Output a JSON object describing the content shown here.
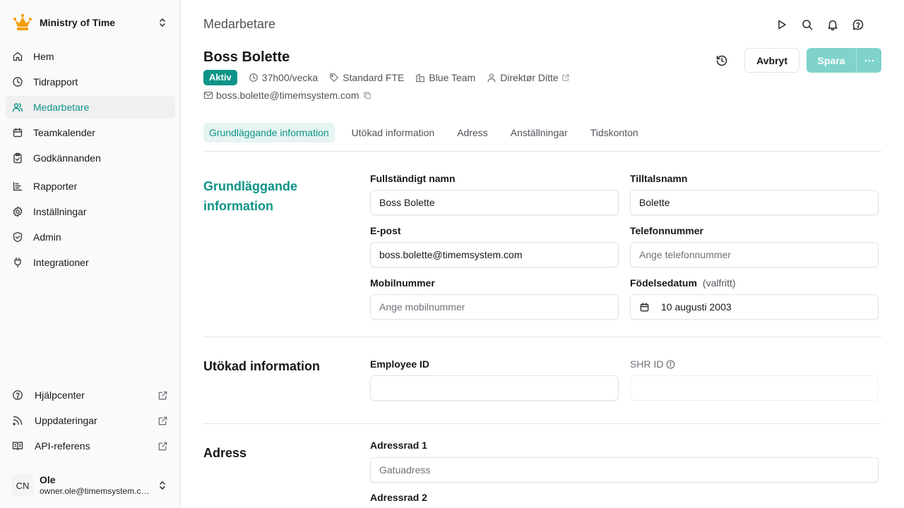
{
  "org": {
    "name": "Ministry of Time"
  },
  "nav": [
    {
      "label": "Hem"
    },
    {
      "label": "Tidrapport"
    },
    {
      "label": "Medarbetare"
    },
    {
      "label": "Teamkalender"
    },
    {
      "label": "Godkännanden"
    },
    {
      "label": "Rapporter"
    },
    {
      "label": "Inställningar"
    },
    {
      "label": "Admin"
    },
    {
      "label": "Integrationer"
    }
  ],
  "bottom_nav": [
    {
      "label": "Hjälpcenter"
    },
    {
      "label": "Uppdateringar"
    },
    {
      "label": "API-referens"
    }
  ],
  "user": {
    "initials": "CN",
    "name": "Ole",
    "email": "owner.ole@timemsystem.com"
  },
  "page": {
    "title": "Medarbetare"
  },
  "employee": {
    "name": "Boss Bolette",
    "status": "Aktiv",
    "hours": "37h00/vecka",
    "fte": "Standard FTE",
    "team": "Blue Team",
    "manager": "Direktør Ditte",
    "email": "boss.bolette@timemsystem.com"
  },
  "actions": {
    "cancel": "Avbryt",
    "save": "Spara"
  },
  "tabs": [
    "Grundläggande information",
    "Utökad information",
    "Adress",
    "Anställningar",
    "Tidskonton"
  ],
  "basic": {
    "title": "Grundläggande information",
    "full_name_label": "Fullständigt namn",
    "full_name": "Boss Bolette",
    "nickname_label": "Tilltalsnamn",
    "nickname": "Bolette",
    "email_label": "E-post",
    "email": "boss.bolette@timemsystem.com",
    "phone_label": "Telefonnummer",
    "phone_placeholder": "Ange telefonnummer",
    "mobile_label": "Mobilnummer",
    "mobile_placeholder": "Ange mobilnummer",
    "birth_label": "Födelsedatum",
    "birth_optional": "(valfritt)",
    "birth": "10 augusti 2003"
  },
  "extended": {
    "title": "Utökad information",
    "employee_id_label": "Employee ID",
    "employee_id": "",
    "shr_label": "SHR ID",
    "shr": ""
  },
  "address": {
    "title": "Adress",
    "line1_label": "Adressrad 1",
    "line1_placeholder": "Gatuadress",
    "line2_label": "Adressrad 2"
  },
  "colors": {
    "accent": "#0d9488",
    "save_disabled": "#7fd3cb",
    "crown": "#f59e0b"
  }
}
